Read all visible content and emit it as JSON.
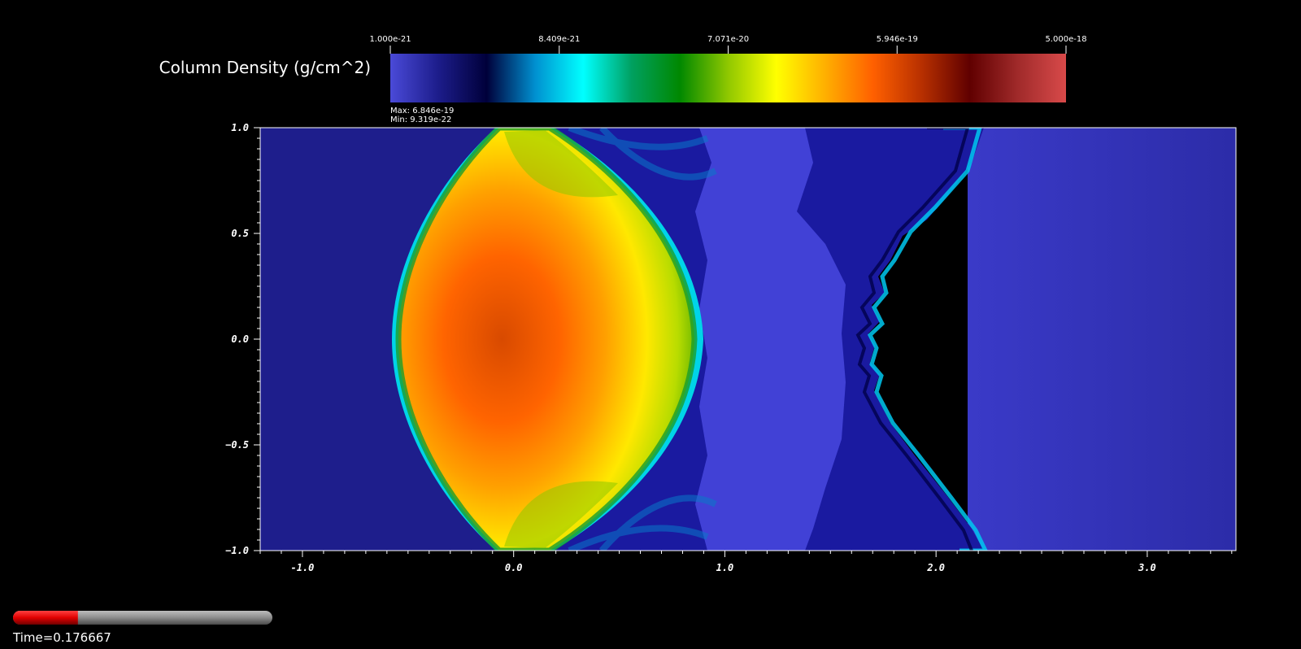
{
  "chart_data": {
    "type": "heatmap",
    "field": "Column Density (g/cm^2)",
    "colormap": {
      "scale": "log",
      "ticks": [
        "1.000e-21",
        "8.409e-21",
        "7.071e-20",
        "5.946e-19",
        "5.000e-18"
      ],
      "range": [
        1e-21,
        5e-18
      ],
      "stops": [
        "#4a4ad8",
        "#1c1c8a",
        "#00003a",
        "#0090d0",
        "#00ffff",
        "#00a060",
        "#008800",
        "#90c800",
        "#ffff00",
        "#ffb000",
        "#ff6000",
        "#b83000",
        "#600000",
        "#a02a2a",
        "#d84a4a"
      ],
      "max_label": "Max:  6.846e-19",
      "min_label": "Min:  9.319e-22"
    },
    "x_ticks": [
      "-1.0",
      "0.0",
      "1.0",
      "2.0",
      "3.0"
    ],
    "y_ticks": [
      "1.0",
      "0.5",
      "0.0",
      "−0.5",
      "−1.0"
    ],
    "xlim": [
      -1.2,
      3.42
    ],
    "ylim": [
      -1.0,
      1.0
    ],
    "x_tick_values": [
      -1.0,
      0.0,
      1.0,
      2.0,
      3.0
    ],
    "y_tick_values": [
      1.0,
      0.5,
      0.0,
      -0.5,
      -1.0
    ],
    "features": {
      "cloud": {
        "center": [
          0.1,
          0.0
        ],
        "peak_density": 6.846e-19
      },
      "background_density": 9.319e-22
    }
  },
  "time_slider": {
    "label": "Time=0.176667",
    "fraction": 0.25
  }
}
